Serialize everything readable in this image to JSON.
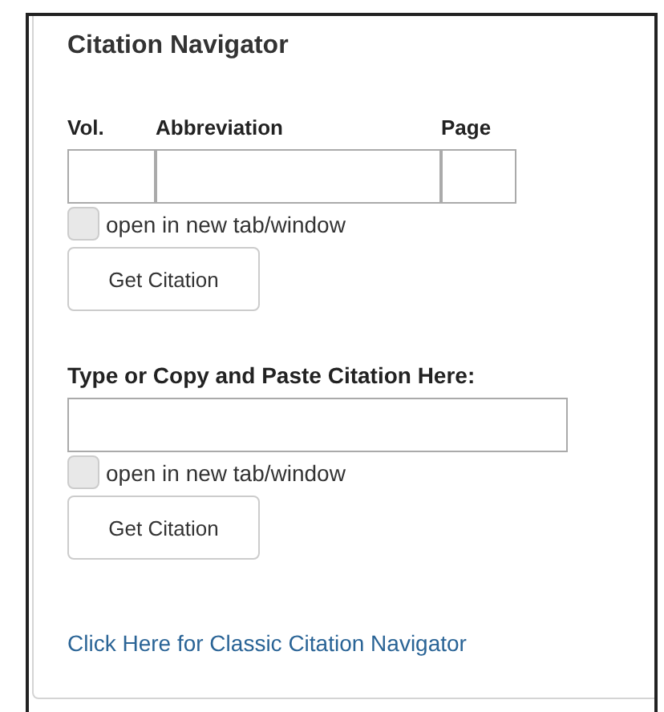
{
  "title": "Citation Navigator",
  "fields": {
    "labels": [
      "Vol.",
      "Abbreviation",
      "Page"
    ]
  },
  "open_new_1": {
    "label": "open in new tab/window",
    "checked": false
  },
  "button_1": "Get Citation",
  "paste": {
    "label": "Type or Copy and Paste Citation Here:"
  },
  "open_new_2": {
    "label": "open in new tab/window",
    "checked": false
  },
  "button_2": "Get Citation",
  "link": "Click Here for Classic Citation Navigator"
}
